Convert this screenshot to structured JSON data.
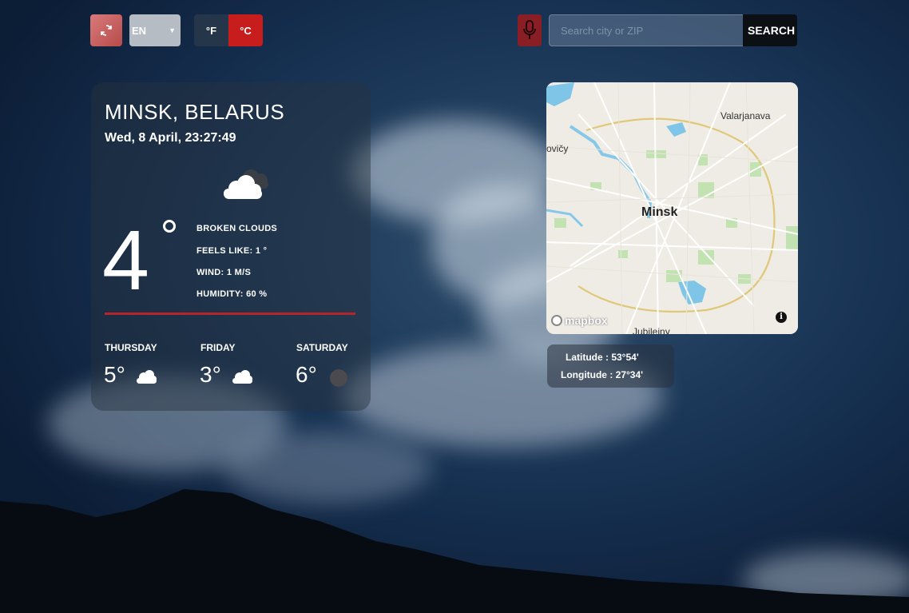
{
  "topbar": {
    "language": "EN",
    "unit_f": "°F",
    "unit_c": "°C",
    "search_placeholder": "Search city or ZIP",
    "search_label": "SEARCH"
  },
  "weather": {
    "city": "MINSK, BELARUS",
    "datetime": "Wed, 8 April, 23:27:49",
    "temperature": "4",
    "condition": "BROKEN CLOUDS",
    "feels_like": "FEELS LIKE: 1 °",
    "wind": "WIND: 1 M/S",
    "humidity": "HUMIDITY: 60 %",
    "icon": "broken-clouds-icon"
  },
  "forecast": [
    {
      "day": "THURSDAY",
      "temp": "5°",
      "icon": "cloud-icon"
    },
    {
      "day": "FRIDAY",
      "temp": "3°",
      "icon": "cloud-icon"
    },
    {
      "day": "SATURDAY",
      "temp": "6°",
      "icon": "overcast-icon"
    }
  ],
  "map": {
    "city_label": "Minsk",
    "labels": [
      "Valarjanava",
      "ovičy",
      "Jubilejny"
    ],
    "attribution": "mapbox"
  },
  "coordinates": {
    "latitude": "Latitude : 53°54'",
    "longitude": "Longitude : 27°34'"
  },
  "colors": {
    "accent_red": "#c81d1d",
    "divider_red": "#b8242b"
  }
}
